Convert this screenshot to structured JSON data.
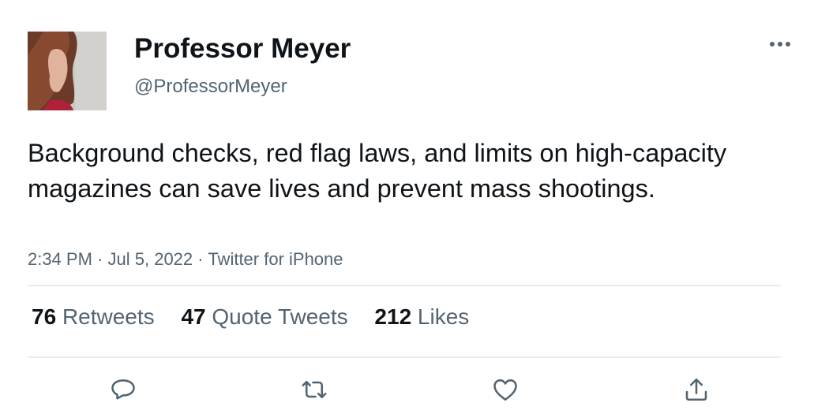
{
  "user": {
    "name": "Professor Meyer",
    "handle": "@ProfessorMeyer"
  },
  "tweet": {
    "text": "Background checks, red flag laws, and limits on high-capacity magazines can save lives and prevent mass shootings.",
    "time": "2:34 PM",
    "date": "Jul 5, 2022",
    "source": "Twitter for iPhone"
  },
  "stats": [
    {
      "count": "76",
      "label": "Retweets"
    },
    {
      "count": "47",
      "label": "Quote Tweets"
    },
    {
      "count": "212",
      "label": "Likes"
    }
  ],
  "actions": [
    "reply-icon",
    "retweet-icon",
    "like-icon",
    "share-icon"
  ],
  "colors": {
    "text": "#0f1419",
    "secondary": "#536471",
    "divider": "#e6ecf0"
  }
}
